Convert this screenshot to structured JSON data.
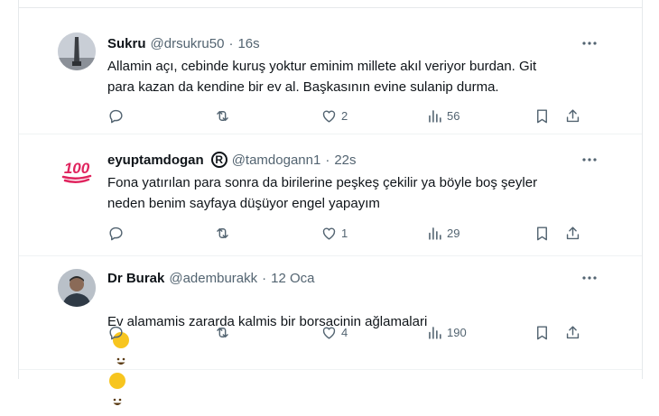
{
  "tweets": [
    {
      "name": "Sukru",
      "handle": "@drsukru50",
      "separator": "·",
      "time": "16s",
      "text": "Allamin açı, cebinde kuruş yoktur eminim millete akıl veriyor burdan. Git\npara kazan da kendine bir ev al. Başkasının evine sulanip durma.",
      "likes": "2",
      "views": "56",
      "avatar": "monument-photo-avatar"
    },
    {
      "name": "eyuptamdogan",
      "badge": "R",
      "handle": "@tamdogann1",
      "separator": "·",
      "time": "22s",
      "text": "Fona yatırılan para sonra da birilerine peşkeş çekilir ya böyle boş şeyler\nneden benim sayfaya düşüyor engel yapayım",
      "likes": "1",
      "views": "29",
      "avatar": "hundred-points-emoji-avatar",
      "avatar_text": "100"
    },
    {
      "name": "Dr Burak",
      "handle": "@ademburakk",
      "separator": "·",
      "time": "12 Oca",
      "text": "Ev alamamis zararda kalmis bir borsacinin ağlamalari",
      "likes": "4",
      "views": "190",
      "avatar": "person-photo-avatar"
    }
  ],
  "colors": {
    "text": "#0f1419",
    "secondary": "#536471",
    "border": "#eff3f4",
    "emoji100": "#e0245e"
  },
  "icons": [
    "reply-icon",
    "retweet-icon",
    "like-icon",
    "views-icon",
    "bookmark-icon",
    "share-icon",
    "more-icon",
    "grinning-face-emoji"
  ]
}
